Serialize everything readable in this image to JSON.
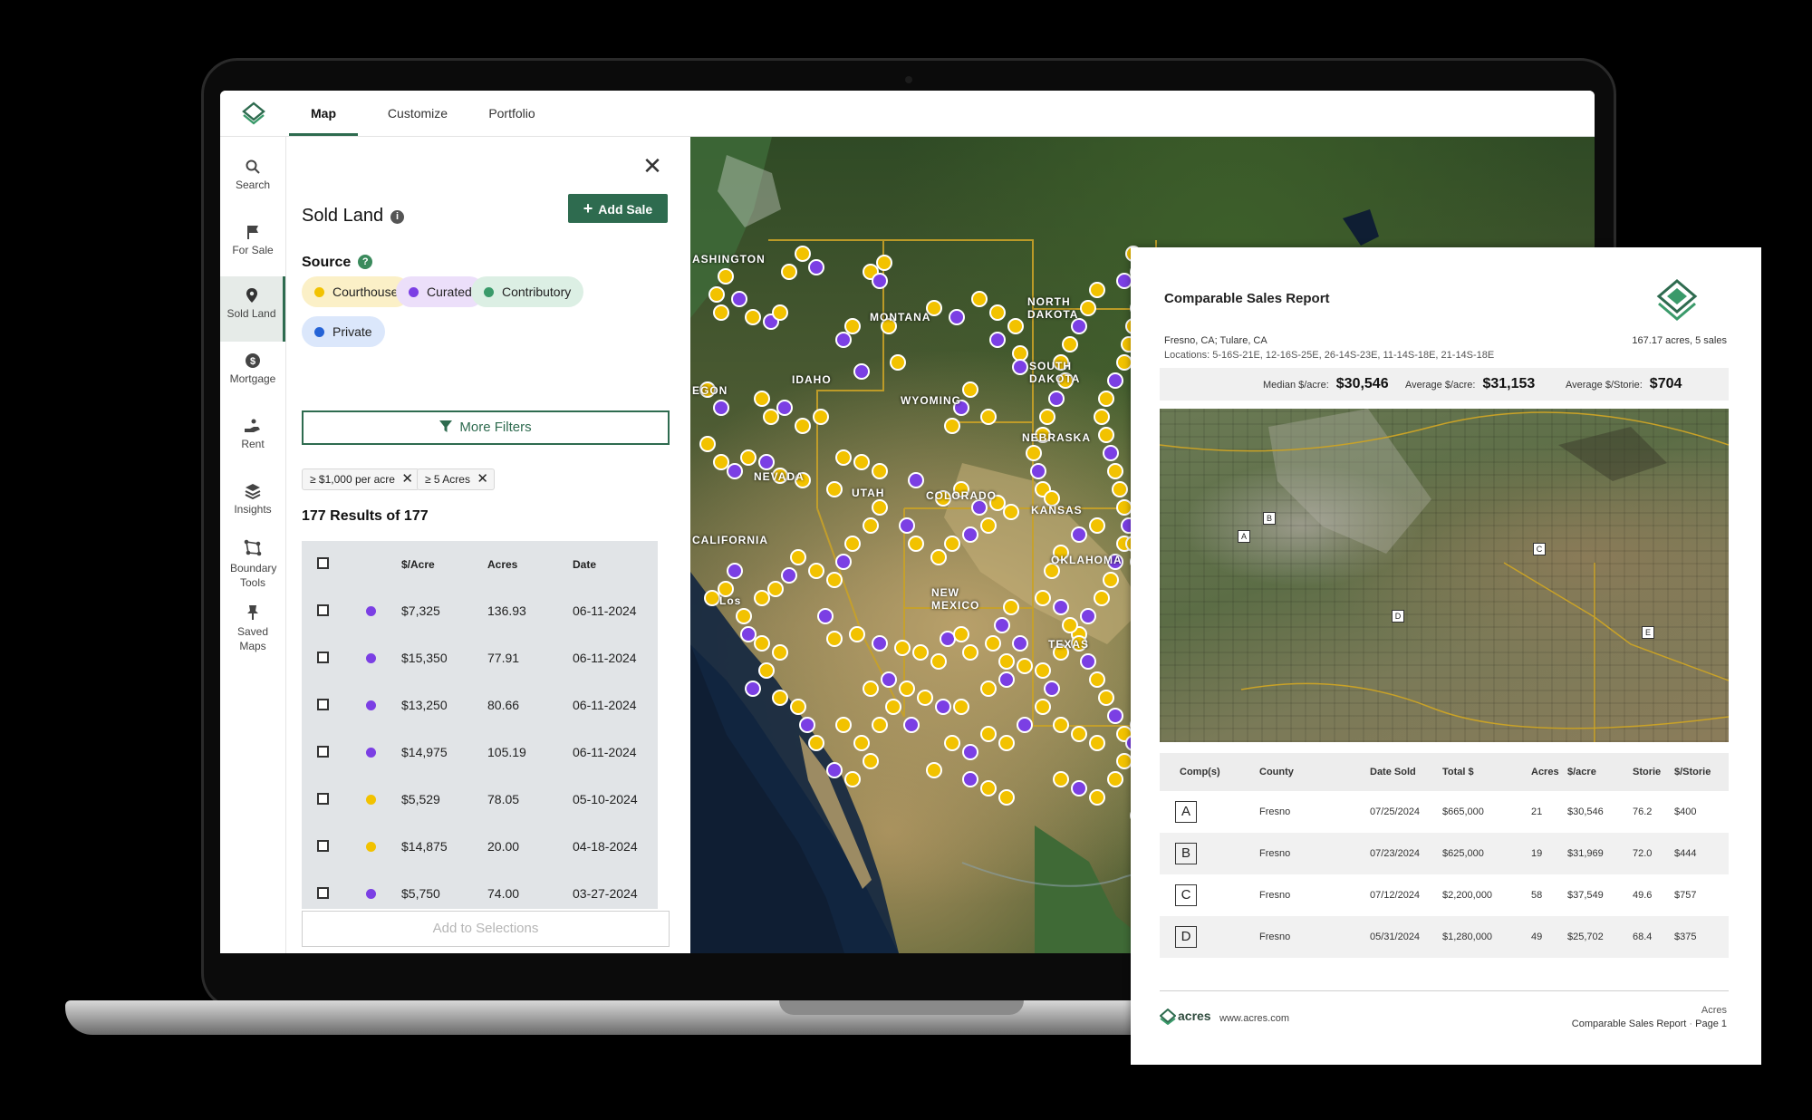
{
  "app": {
    "tabs": [
      {
        "label": "Map",
        "active": true
      },
      {
        "label": "Customize",
        "active": false
      },
      {
        "label": "Portfolio",
        "active": false
      }
    ],
    "brand_color": "#2e6b4f"
  },
  "rail": {
    "items": [
      {
        "label": "Search",
        "icon": "search-icon"
      },
      {
        "label": "For Sale",
        "icon": "flag-icon"
      },
      {
        "label": "Sold Land",
        "icon": "map-pin-icon",
        "active": true
      },
      {
        "label": "Mortgage",
        "icon": "dollar-icon"
      },
      {
        "label": "Rent",
        "icon": "hand-icon"
      },
      {
        "label": "Insights",
        "icon": "layers-icon"
      },
      {
        "label": "Boundary Tools",
        "icon": "polygon-icon"
      },
      {
        "label": "Saved Maps",
        "icon": "pushpin-icon"
      }
    ]
  },
  "panel": {
    "title": "Sold Land",
    "add_sale_label": "Add Sale",
    "source_label": "Source",
    "sources": [
      {
        "label": "Courthouse",
        "color": "#f2c200",
        "bg": "#fbf0c7"
      },
      {
        "label": "Curated",
        "color": "#7b3fe4",
        "bg": "#ecdffa"
      },
      {
        "label": "Contributory",
        "color": "#3a9a6a",
        "bg": "#dcefe4"
      },
      {
        "label": "Private",
        "color": "#2563d6",
        "bg": "#dbe7fb"
      }
    ],
    "more_filters_label": "More Filters",
    "active_filters": [
      "≥ $1,000 per acre",
      "≥ 5 Acres"
    ],
    "results_text": "177 Results of 177",
    "table": {
      "headers": [
        "$/Acre",
        "Acres",
        "Date"
      ],
      "rows": [
        {
          "price": "$7,325",
          "acres": "136.93",
          "date": "06-11-2024",
          "source_color": "#7b3fe4"
        },
        {
          "price": "$15,350",
          "acres": "77.91",
          "date": "06-11-2024",
          "source_color": "#7b3fe4"
        },
        {
          "price": "$13,250",
          "acres": "80.66",
          "date": "06-11-2024",
          "source_color": "#7b3fe4"
        },
        {
          "price": "$14,975",
          "acres": "105.19",
          "date": "06-11-2024",
          "source_color": "#7b3fe4"
        },
        {
          "price": "$5,529",
          "acres": "78.05",
          "date": "05-10-2024",
          "source_color": "#f2c200"
        },
        {
          "price": "$14,875",
          "acres": "20.00",
          "date": "04-18-2024",
          "source_color": "#f2c200"
        },
        {
          "price": "$5,750",
          "acres": "74.00",
          "date": "03-27-2024",
          "source_color": "#7b3fe4"
        }
      ]
    },
    "add_to_selections_label": "Add to Selections"
  },
  "map": {
    "labels": [
      "ASHINGTON",
      "MONTANA",
      "NORTH DAKOTA",
      "IDAHO",
      "EGON",
      "WYOMING",
      "SOUTH DAKOTA",
      "NEBRASKA",
      "NEVADA",
      "UTAH",
      "COLORADO",
      "KANSAS",
      "CALIFORNIA",
      "NEW MEXICO",
      "OKLAHOMA",
      "TEXAS",
      "Los"
    ]
  },
  "report": {
    "title": "Comparable Sales Report",
    "location": "Fresno, CA; Tulare, CA",
    "locations_line": "Locations: 5-16S-21E, 12-16S-25E, 26-14S-23E, 11-14S-18E, 21-14S-18E",
    "summary": "167.17 acres, 5 sales",
    "stats": [
      {
        "label": "Median $/acre:",
        "value": "$30,546"
      },
      {
        "label": "Average $/acre:",
        "value": "$31,153"
      },
      {
        "label": "Average $/Storie:",
        "value": "$704"
      }
    ],
    "map_markers": [
      "A",
      "B",
      "C",
      "D",
      "E"
    ],
    "table_headers": [
      "Comp(s)",
      "County",
      "Date Sold",
      "Total $",
      "Acres",
      "$/acre",
      "Storie",
      "$/Storie"
    ],
    "rows": [
      {
        "comp": "A",
        "county": "Fresno",
        "date": "07/25/2024",
        "total": "$665,000",
        "acres": "21",
        "per_acre": "$30,546",
        "storie": "76.2",
        "per_storie": "$400"
      },
      {
        "comp": "B",
        "county": "Fresno",
        "date": "07/23/2024",
        "total": "$625,000",
        "acres": "19",
        "per_acre": "$31,969",
        "storie": "72.0",
        "per_storie": "$444"
      },
      {
        "comp": "C",
        "county": "Fresno",
        "date": "07/12/2024",
        "total": "$2,200,000",
        "acres": "58",
        "per_acre": "$37,549",
        "storie": "49.6",
        "per_storie": "$757"
      },
      {
        "comp": "D",
        "county": "Fresno",
        "date": "05/31/2024",
        "total": "$1,280,000",
        "acres": "49",
        "per_acre": "$25,702",
        "storie": "68.4",
        "per_storie": "$375"
      }
    ],
    "footer_brand": "acres",
    "footer_url": "www.acres.com",
    "footer_company": "Acres",
    "footer_doc": "Comparable Sales Report",
    "footer_page": "Page 1"
  }
}
